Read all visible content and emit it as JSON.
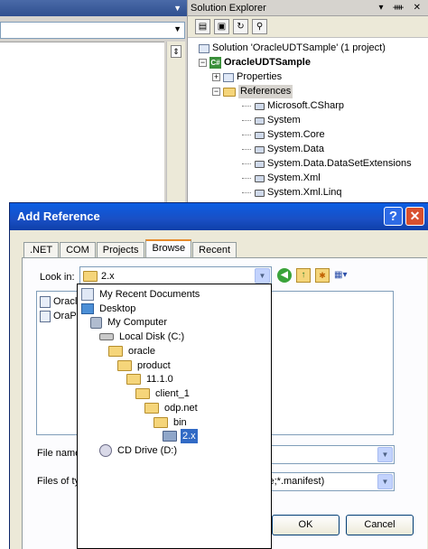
{
  "ide": {
    "solution_explorer_title": "Solution Explorer",
    "pin_glyph": "▾ ᚓ ✕",
    "tree": [
      {
        "label": "Solution 'OracleUDTSample' (1 project)",
        "kind": "solution"
      },
      {
        "label": "OracleUDTSample",
        "kind": "project"
      },
      {
        "label": "Properties",
        "kind": "folder"
      },
      {
        "label": "References",
        "kind": "folder"
      },
      {
        "label": "Microsoft.CSharp",
        "kind": "ref"
      },
      {
        "label": "System",
        "kind": "ref"
      },
      {
        "label": "System.Core",
        "kind": "ref"
      },
      {
        "label": "System.Data",
        "kind": "ref"
      },
      {
        "label": "System.Data.DataSetExtensions",
        "kind": "ref"
      },
      {
        "label": "System.Xml",
        "kind": "ref"
      },
      {
        "label": "System.Xml.Linq",
        "kind": "ref"
      }
    ]
  },
  "dialog": {
    "title": "Add Reference",
    "help_glyph": "?",
    "close_glyph": "✕",
    "tabs": [
      ".NET",
      "COM",
      "Projects",
      "Browse",
      "Recent"
    ],
    "active_tab": "Browse",
    "look_in_label": "Look in:",
    "look_in_value": "2.x",
    "files": [
      "Oracle",
      "OraPr"
    ],
    "file_name_label": "File name",
    "files_of_type_label": "Files of typ",
    "files_of_type_value": "xe;*.manifest)",
    "ok_label": "OK",
    "cancel_label": "Cancel"
  },
  "dropdown": {
    "items": [
      {
        "label": "My Recent Documents",
        "icon": "recent-docs-icon"
      },
      {
        "label": "Desktop",
        "icon": "desktop-icon"
      },
      {
        "label": "My Computer",
        "icon": "computer-icon"
      },
      {
        "label": "Local Disk (C:)",
        "icon": "disk-icon"
      },
      {
        "label": "oracle",
        "icon": "folder-icon"
      },
      {
        "label": "product",
        "icon": "folder-icon"
      },
      {
        "label": "11.1.0",
        "icon": "folder-icon"
      },
      {
        "label": "client_1",
        "icon": "folder-icon"
      },
      {
        "label": "odp.net",
        "icon": "folder-icon"
      },
      {
        "label": "bin",
        "icon": "folder-icon"
      },
      {
        "label": "2.x",
        "icon": "folder-open-icon"
      },
      {
        "label": "CD Drive (D:)",
        "icon": "cd-drive-icon"
      }
    ],
    "selected": "2.x"
  }
}
